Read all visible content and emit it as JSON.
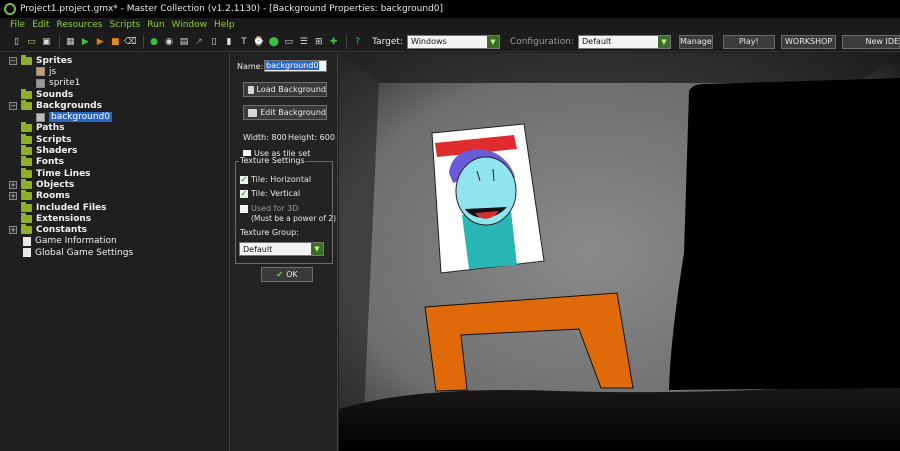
{
  "window": {
    "title": "Project1.project.gmx* - Master Collection (v1.2.1130) - [Background Properties: background0]"
  },
  "menu": [
    "File",
    "Edit",
    "Resources",
    "Scripts",
    "Run",
    "Window",
    "Help"
  ],
  "toolbar": {
    "icons": [
      "new-project-icon",
      "open-icon",
      "save-icon",
      "separator",
      "create-executable-icon",
      "run-icon",
      "debug-icon",
      "stop-icon",
      "clean-icon",
      "separator",
      "add-sprite-icon",
      "add-sound-icon",
      "add-background-icon",
      "add-path-icon",
      "add-script-icon",
      "add-shader-icon",
      "add-font-icon",
      "add-timeline-icon",
      "add-object-icon",
      "add-room-icon",
      "game-info-icon",
      "global-settings-icon",
      "add-extension-icon",
      "separator",
      "help-icon"
    ],
    "target_label": "Target:",
    "target_value": "Windows",
    "configuration_label": "Configuration:",
    "configuration_value": "Default",
    "manage_label": "Manage",
    "play_label": "Play!",
    "workshop_label": "WORKSHOP",
    "new_label": "New IDE"
  },
  "tree": [
    {
      "label": "Sprites",
      "expanded": true,
      "level": 0,
      "type": "folder"
    },
    {
      "label": "js",
      "level": 1,
      "type": "sprite"
    },
    {
      "label": "sprite1",
      "level": 1,
      "type": "sprite"
    },
    {
      "label": "Sounds",
      "level": 0,
      "type": "folder"
    },
    {
      "label": "Backgrounds",
      "expanded": true,
      "level": 0,
      "type": "folder"
    },
    {
      "label": "background0",
      "level": 1,
      "type": "background",
      "selected": true
    },
    {
      "label": "Paths",
      "level": 0,
      "type": "folder"
    },
    {
      "label": "Scripts",
      "level": 0,
      "type": "folder"
    },
    {
      "label": "Shaders",
      "level": 0,
      "type": "folder"
    },
    {
      "label": "Fonts",
      "level": 0,
      "type": "folder"
    },
    {
      "label": "Time Lines",
      "level": 0,
      "type": "folder"
    },
    {
      "label": "Objects",
      "expandable": true,
      "level": 0,
      "type": "folder"
    },
    {
      "label": "Rooms",
      "expandable": true,
      "level": 0,
      "type": "folder"
    },
    {
      "label": "Included Files",
      "level": 0,
      "type": "folder"
    },
    {
      "label": "Extensions",
      "level": 0,
      "type": "folder"
    },
    {
      "label": "Constants",
      "expandable": true,
      "level": 0,
      "type": "folder"
    },
    {
      "label": "Game Information",
      "level": 0,
      "type": "info"
    },
    {
      "label": "Global Game Settings",
      "level": 0,
      "type": "settings"
    }
  ],
  "props": {
    "name_label": "Name:",
    "name_value": "background0",
    "load_label": "Load Background",
    "edit_label": "Edit Background",
    "width_text": "Width: 800",
    "height_text": "Height: 600",
    "tileset_label": "Use as tile set",
    "texture_settings_label": "Texture Settings",
    "tile_h_label": "Tile: Horizontal",
    "tile_v_label": "Tile: Vertical",
    "used3d_label": "Used for 3D",
    "used3d_note": "(Must be a power of 2)",
    "texture_group_label": "Texture Group:",
    "texture_group_value": "Default",
    "ok_label": "OK",
    "tileset_checked": false,
    "tile_h_checked": true,
    "tile_v_checked": true,
    "used3d_checked": false
  },
  "colors": {
    "accent_green": "#8ccf3c",
    "selection_blue": "#2a66c8",
    "preview_wall": "#7a7a7a",
    "preview_orange": "#e06a0a",
    "poster_teal": "#2bb6b6",
    "poster_face": "#8fe4f0"
  }
}
